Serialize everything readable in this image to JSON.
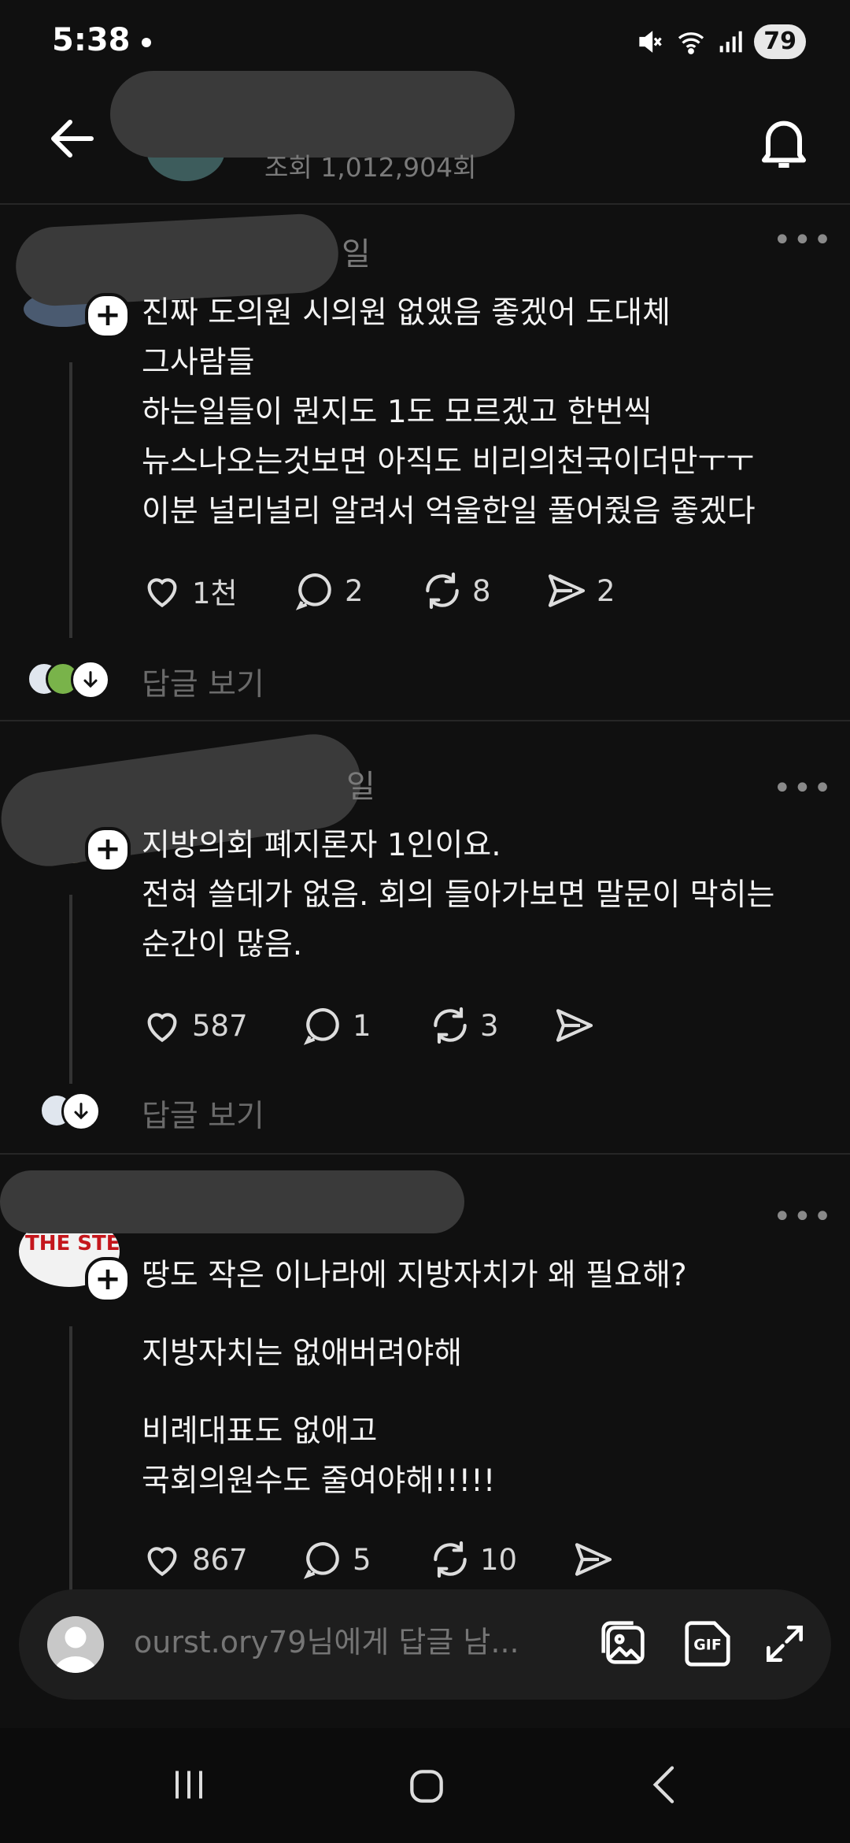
{
  "status_bar": {
    "time": "5:38",
    "battery": "79"
  },
  "header": {
    "views": "조회 1,012,904회"
  },
  "comments": [
    {
      "username_fragment": "일",
      "lines": [
        "진짜 도의원 시의원 없앴음 좋겠어 도대체",
        "그사람들",
        "하는일들이 뭔지도 1도 모르겠고 한번씩",
        "뉴스나오는것보면 아직도 비리의천국이더만ㅜㅜ",
        "이분 널리널리 알려서 억울한일 풀어줬음 좋겠다"
      ],
      "likes": "1천",
      "replies": "2",
      "reposts": "8",
      "shares": "2",
      "view_replies": "답글 보기"
    },
    {
      "username_fragment": "일",
      "lines": [
        "지방의회 폐지론자 1인이요.",
        "전혀 쓸데가 없음. 회의 들아가보면 말문이 막히는",
        "순간이 많음."
      ],
      "likes": "587",
      "replies": "1",
      "reposts": "3",
      "shares": "",
      "view_replies": "답글 보기"
    },
    {
      "paragraphs": [
        [
          "땅도 작은 이나라에 지방자치가 왜 필요해?"
        ],
        [
          "지방자치는 없애버려야해"
        ],
        [
          "비례대표도 없애고",
          "국회의원수도 줄여야해!!!!!"
        ]
      ],
      "avatar_text": "THE STE",
      "likes": "867",
      "replies": "5",
      "reposts": "10",
      "shares": ""
    }
  ],
  "composer": {
    "placeholder": "ourst.ory79님에게 답글 남..."
  },
  "icons": {
    "back": "arrow-left-icon",
    "bell": "bell-icon",
    "like": "heart-icon",
    "reply": "speech-bubble-icon",
    "repost": "repost-icon",
    "share": "send-icon",
    "image": "image-icon",
    "gif": "gif-icon",
    "expand": "expand-icon"
  }
}
